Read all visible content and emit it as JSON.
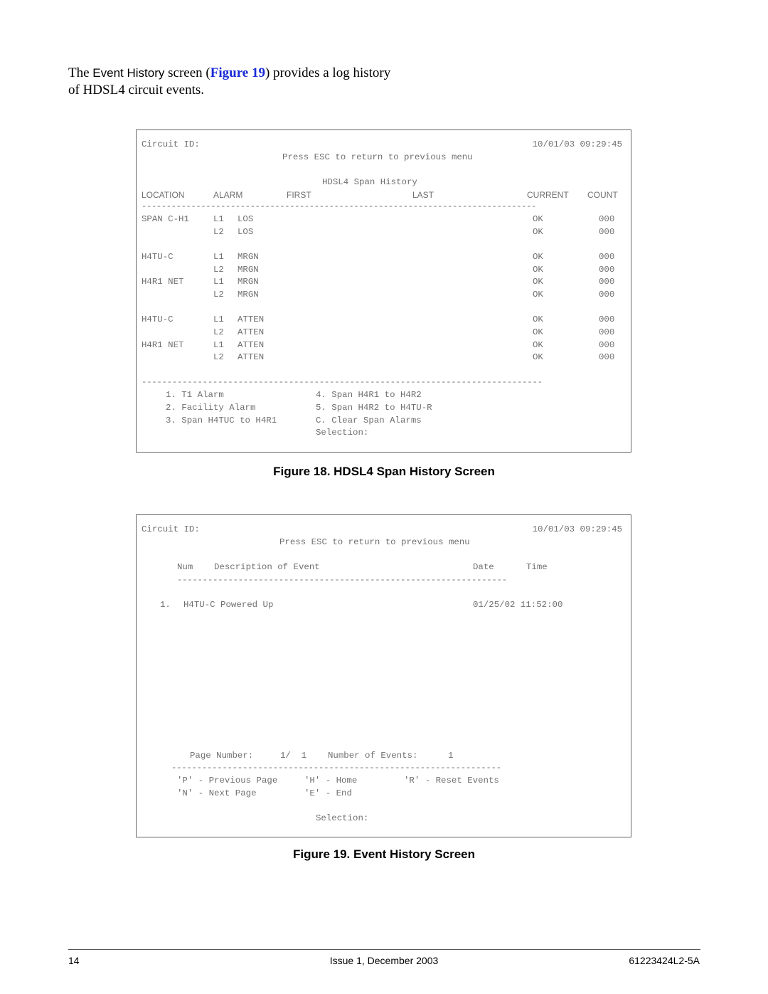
{
  "intro": {
    "part1": "The ",
    "screen_name": "Event History",
    "part2": " screen (",
    "link": "Figure 19",
    "part3": ") provides a log history of HDSL4 circuit events."
  },
  "fig18": {
    "circuit_label": "Circuit ID:",
    "datetime": "10/01/03 09:29:45",
    "esc_hint": "Press ESC to return to previous menu",
    "title": "HDSL4 Span History",
    "headers": {
      "location": "LOCATION",
      "alarm": "ALARM",
      "first": "FIRST",
      "last": "LAST",
      "current": "CURRENT",
      "count": "COUNT"
    },
    "rule": "--------------------------------------------------------------------------------",
    "rule_full": "-------------------------------------------------------------------------------",
    "rows": [
      {
        "location": "SPAN C-H1",
        "line": "L1",
        "alarm": "LOS",
        "current": "OK",
        "count": "000"
      },
      {
        "location": "",
        "line": "L2",
        "alarm": "LOS",
        "current": "OK",
        "count": "000"
      },
      {
        "location": "H4TU-C",
        "line": "L1",
        "alarm": "MRGN",
        "current": "OK",
        "count": "000"
      },
      {
        "location": "",
        "line": "L2",
        "alarm": "MRGN",
        "current": "OK",
        "count": "000"
      },
      {
        "location": "H4R1 NET",
        "line": "L1",
        "alarm": "MRGN",
        "current": "OK",
        "count": "000"
      },
      {
        "location": "",
        "line": "L2",
        "alarm": "MRGN",
        "current": "OK",
        "count": "000"
      },
      {
        "location": "H4TU-C",
        "line": "L1",
        "alarm": "ATTEN",
        "current": "OK",
        "count": "000"
      },
      {
        "location": "",
        "line": "L2",
        "alarm": "ATTEN",
        "current": "OK",
        "count": "000"
      },
      {
        "location": "H4R1 NET",
        "line": "L1",
        "alarm": "ATTEN",
        "current": "OK",
        "count": "000"
      },
      {
        "location": "",
        "line": "L2",
        "alarm": "ATTEN",
        "current": "OK",
        "count": "000"
      }
    ],
    "menu_left": [
      "1. T1 Alarm",
      "2. Facility Alarm",
      "3. Span H4TUC to H4R1"
    ],
    "menu_right": [
      "4. Span H4R1 to H4R2",
      "5. Span H4R2 to H4TU-R",
      "C. Clear Span Alarms"
    ],
    "selection": "Selection:",
    "caption": "Figure 18.  HDSL4 Span History Screen"
  },
  "fig19": {
    "circuit_label": "Circuit ID:",
    "datetime": "10/01/03 09:29:45",
    "esc_hint": "Press ESC to return to previous menu",
    "headers": {
      "num": "Num",
      "description": "Description of Event",
      "date": "Date",
      "time": "Time"
    },
    "rule": "-----------------------------------------------------------------",
    "events": [
      {
        "num": "1.",
        "description": "H4TU-C Powered Up",
        "datetime": "01/25/02 11:52:00"
      }
    ],
    "page_label": "Page Number:",
    "page_value": "1/  1",
    "events_label": "Number of Events:",
    "events_count": "1",
    "commands": {
      "prev": "'P' - Previous Page",
      "home": "'H' - Home",
      "reset": "'R' - Reset Events",
      "next": "'N' - Next Page",
      "end": "'E' - End"
    },
    "selection": "Selection:",
    "caption": "Figure 19.  Event History Screen"
  },
  "footer": {
    "page": "14",
    "issue": "Issue 1, December 2003",
    "doc_number": "61223424L2-5A"
  }
}
